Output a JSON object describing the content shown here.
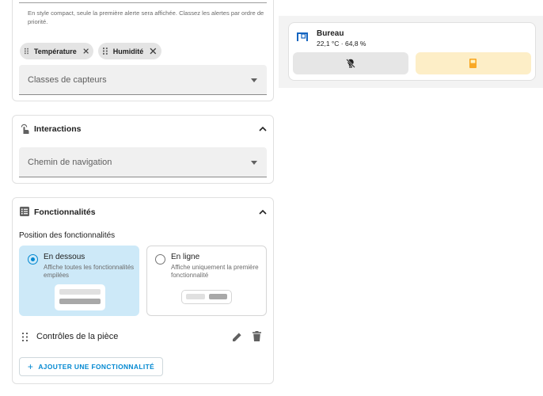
{
  "sensor_section": {
    "note": "En style compact, seule la première alerte sera affichée. Classez les alertes par ordre de priorité.",
    "chips": [
      {
        "label": "Température",
        "remove_icon": "close-icon"
      },
      {
        "label": "Humidité",
        "remove_icon": "close-icon"
      }
    ],
    "sensor_classes_label": "Classes de capteurs"
  },
  "interactions": {
    "title": "Interactions",
    "icon": "gesture-tap-icon",
    "navigation_path_label": "Chemin de navigation"
  },
  "features": {
    "title": "Fonctionnalités",
    "icon": "list-box-icon",
    "position_label": "Position des fonctionnalités",
    "options": [
      {
        "title": "En dessous",
        "description": "Affiche toutes les fonctionnalités empilées",
        "selected": true
      },
      {
        "title": "En ligne",
        "description": "Affiche uniquement la première fonctionnalité",
        "selected": false
      }
    ],
    "feature_item": "Contrôles de la pièce",
    "add_button": "AJOUTER UNE FONCTIONNALITÉ",
    "accent_color": "#03a9f4"
  },
  "preview": {
    "room_name": "Bureau",
    "state": "22,1 °C · 64,8 %",
    "icon": "desk-icon",
    "button_left_icon": "lightbulb-off-icon",
    "button_right_icon": "door-icon",
    "icon_color": "#1565c0",
    "right_button_color": "#fdeec7",
    "right_icon_color": "#f9a825"
  }
}
